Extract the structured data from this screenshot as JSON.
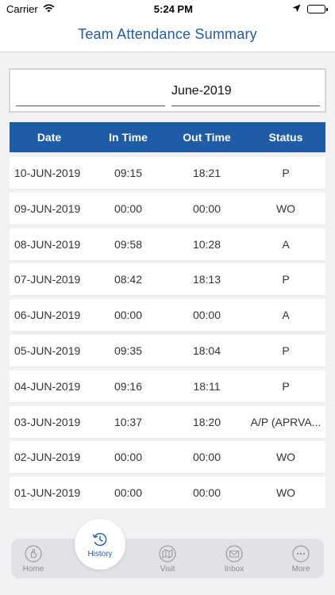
{
  "status_bar": {
    "carrier": "Carrier",
    "time": "5:24 PM",
    "icons": [
      "wifi-icon",
      "location-arrow-icon",
      "battery-icon"
    ]
  },
  "header": {
    "title": "Team Attendance Summary"
  },
  "selector": {
    "left_value": "",
    "month_value": "June-2019"
  },
  "table": {
    "columns": [
      "Date",
      "In Time",
      "Out Time",
      "Status"
    ],
    "rows": [
      {
        "date": "10-JUN-2019",
        "in": "09:15",
        "out": "18:21",
        "status": "P"
      },
      {
        "date": "09-JUN-2019",
        "in": "00:00",
        "out": "00:00",
        "status": "WO"
      },
      {
        "date": "08-JUN-2019",
        "in": "09:58",
        "out": "10:28",
        "status": "A"
      },
      {
        "date": "07-JUN-2019",
        "in": "08:42",
        "out": "18:13",
        "status": "P"
      },
      {
        "date": "06-JUN-2019",
        "in": "00:00",
        "out": "00:00",
        "status": "A"
      },
      {
        "date": "05-JUN-2019",
        "in": "09:35",
        "out": "18:04",
        "status": "P"
      },
      {
        "date": "04-JUN-2019",
        "in": "09:16",
        "out": "18:11",
        "status": "P"
      },
      {
        "date": "03-JUN-2019",
        "in": "10:37",
        "out": "18:20",
        "status": "A/P (APRVA..."
      },
      {
        "date": "02-JUN-2019",
        "in": "00:00",
        "out": "00:00",
        "status": "WO"
      },
      {
        "date": "01-JUN-2019",
        "in": "00:00",
        "out": "00:00",
        "status": "WO"
      }
    ]
  },
  "tabbar": {
    "items": [
      {
        "label": "Home",
        "icon": "hand-icon",
        "active": false
      },
      {
        "label": "History",
        "icon": "clock-history-icon",
        "active": true
      },
      {
        "label": "Visit",
        "icon": "map-icon",
        "active": false
      },
      {
        "label": "Inbox",
        "icon": "mail-icon",
        "active": false
      },
      {
        "label": "More",
        "icon": "more-dots-icon",
        "active": false
      }
    ]
  },
  "colors": {
    "accent": "#1f5ca8",
    "background": "#f2f2f4",
    "inactive_tab": "#8a8a8f"
  }
}
